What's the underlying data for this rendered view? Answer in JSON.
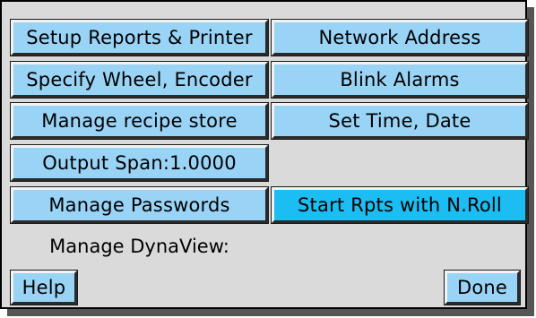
{
  "colors": {
    "panel_background": "#dadada",
    "button_background": "#99d3f5",
    "button_active_background": "#1bbdf3",
    "text": "#000000"
  },
  "menu": {
    "left": [
      "Setup Reports & Printer",
      "Specify Wheel, Encoder",
      "Manage recipe store",
      "Output Span:1.0000",
      "Manage Passwords"
    ],
    "right": [
      "Network Address",
      "Blink Alarms",
      "Set Time, Date",
      "Start Rpts with N.Roll"
    ],
    "active_item": "Start Rpts with N.Roll"
  },
  "dynaview_label": "Manage DynaView:",
  "footer": {
    "help_label": "Help",
    "done_label": "Done"
  }
}
